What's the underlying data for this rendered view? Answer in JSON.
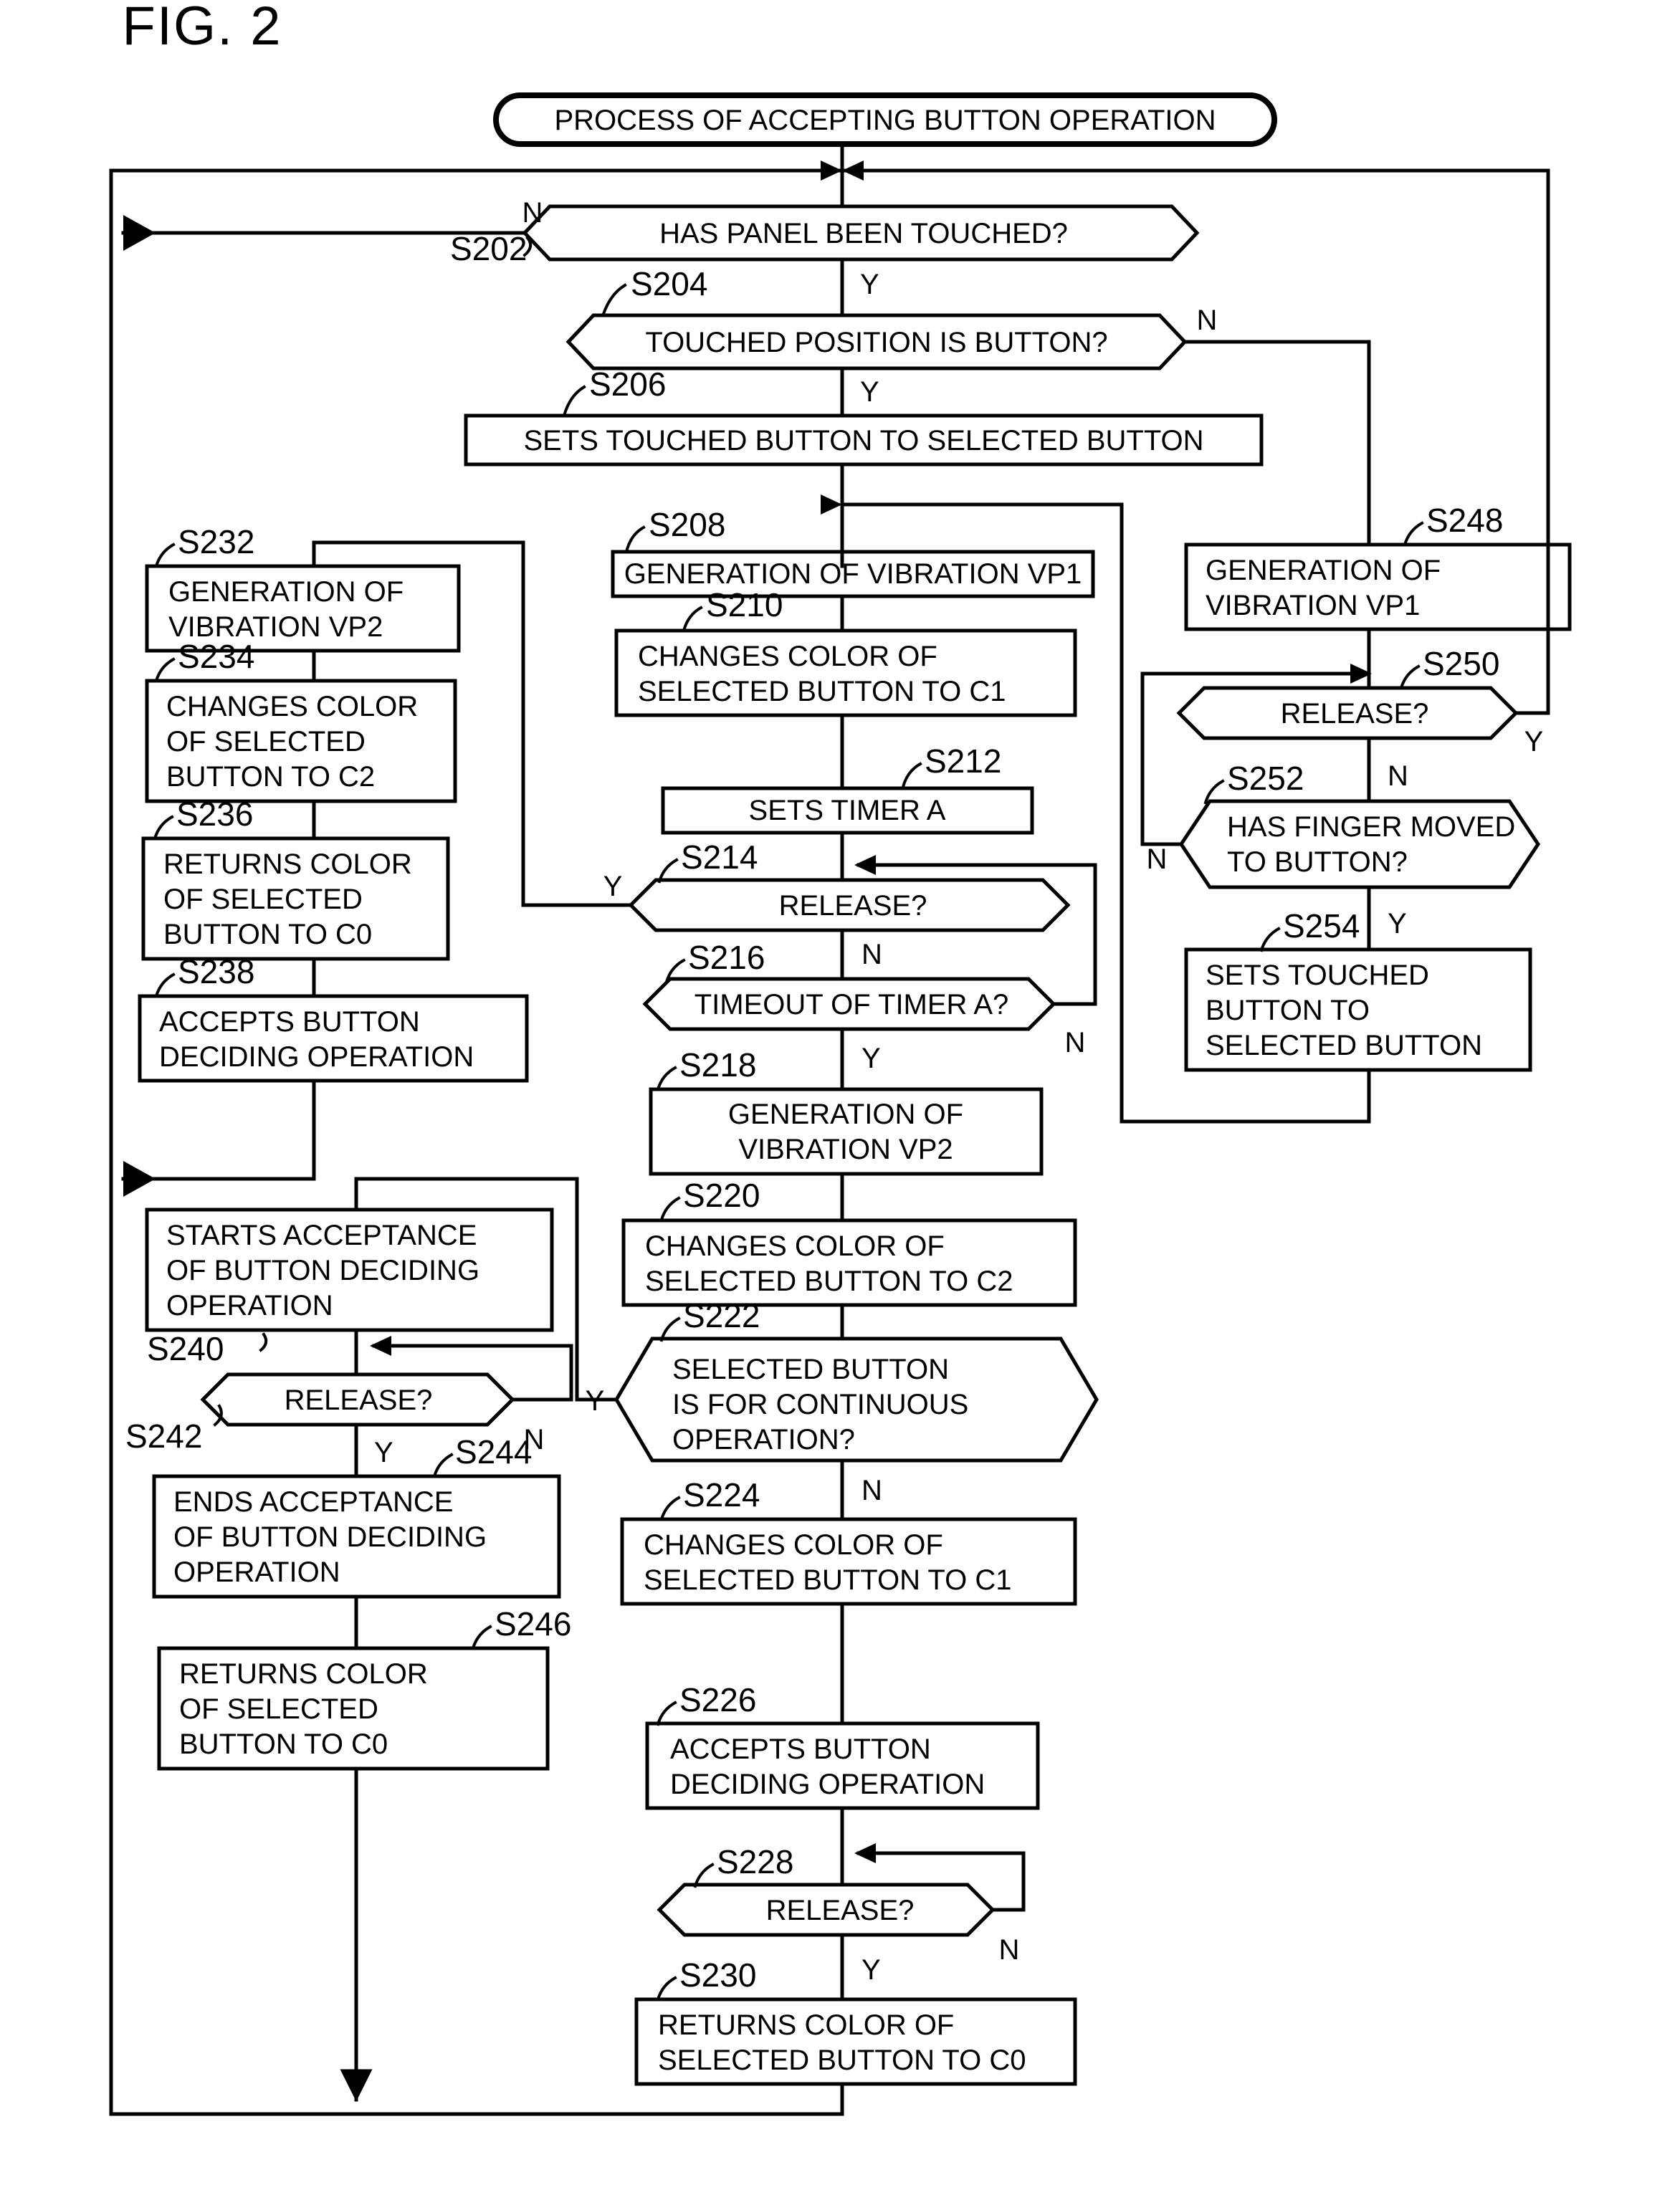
{
  "figure": {
    "title": "FIG. 2",
    "start_node": "PROCESS OF ACCEPTING BUTTON OPERATION"
  },
  "labels": {
    "yes": "Y",
    "no": "N"
  },
  "nodes": [
    {
      "id": "S202",
      "step": "S202",
      "shape": "decision",
      "text": [
        "HAS PANEL BEEN TOUCHED?"
      ]
    },
    {
      "id": "S204",
      "step": "S204",
      "shape": "decision",
      "text": [
        "TOUCHED POSITION IS BUTTON?"
      ]
    },
    {
      "id": "S206",
      "step": "S206",
      "shape": "process",
      "text": [
        "SETS TOUCHED BUTTON TO SELECTED BUTTON"
      ]
    },
    {
      "id": "S208",
      "step": "S208",
      "shape": "process",
      "text": [
        "GENERATION OF VIBRATION VP1"
      ]
    },
    {
      "id": "S210",
      "step": "S210",
      "shape": "process",
      "text": [
        "CHANGES COLOR OF",
        "SELECTED BUTTON TO C1"
      ]
    },
    {
      "id": "S212",
      "step": "S212",
      "shape": "process",
      "text": [
        "SETS TIMER A"
      ]
    },
    {
      "id": "S214",
      "step": "S214",
      "shape": "decision",
      "text": [
        "RELEASE?"
      ]
    },
    {
      "id": "S216",
      "step": "S216",
      "shape": "decision",
      "text": [
        "TIMEOUT OF TIMER A?"
      ]
    },
    {
      "id": "S218",
      "step": "S218",
      "shape": "process",
      "text": [
        "GENERATION OF",
        "VIBRATION VP2"
      ]
    },
    {
      "id": "S220",
      "step": "S220",
      "shape": "process",
      "text": [
        "CHANGES COLOR OF",
        "SELECTED BUTTON TO C2"
      ]
    },
    {
      "id": "S222",
      "step": "S222",
      "shape": "decision",
      "text": [
        "SELECTED BUTTON",
        "IS FOR CONTINUOUS",
        "OPERATION?"
      ]
    },
    {
      "id": "S224",
      "step": "S224",
      "shape": "process",
      "text": [
        "CHANGES COLOR OF",
        "SELECTED BUTTON TO C1"
      ]
    },
    {
      "id": "S226",
      "step": "S226",
      "shape": "process",
      "text": [
        "ACCEPTS BUTTON",
        "DECIDING OPERATION"
      ]
    },
    {
      "id": "S228",
      "step": "S228",
      "shape": "decision",
      "text": [
        "RELEASE?"
      ]
    },
    {
      "id": "S230",
      "step": "S230",
      "shape": "process",
      "text": [
        "RETURNS COLOR OF",
        "SELECTED BUTTON TO C0"
      ]
    },
    {
      "id": "S232",
      "step": "S232",
      "shape": "process",
      "text": [
        "GENERATION OF",
        "VIBRATION VP2"
      ]
    },
    {
      "id": "S234",
      "step": "S234",
      "shape": "process",
      "text": [
        "CHANGES COLOR",
        "OF SELECTED",
        "BUTTON TO C2"
      ]
    },
    {
      "id": "S236",
      "step": "S236",
      "shape": "process",
      "text": [
        "RETURNS COLOR",
        "OF SELECTED",
        "BUTTON TO C0"
      ]
    },
    {
      "id": "S238",
      "step": "S238",
      "shape": "process",
      "text": [
        "ACCEPTS BUTTON",
        "DECIDING OPERATION"
      ]
    },
    {
      "id": "S240",
      "step": "S240",
      "shape": "process",
      "text": [
        "STARTS ACCEPTANCE",
        "OF BUTTON DECIDING",
        "OPERATION"
      ]
    },
    {
      "id": "S242",
      "step": "S242",
      "shape": "decision",
      "text": [
        "RELEASE?"
      ]
    },
    {
      "id": "S244",
      "step": "S244",
      "shape": "process",
      "text": [
        "ENDS ACCEPTANCE",
        "OF BUTTON DECIDING",
        "OPERATION"
      ]
    },
    {
      "id": "S246",
      "step": "S246",
      "shape": "process",
      "text": [
        "RETURNS COLOR",
        "OF SELECTED",
        "BUTTON TO C0"
      ]
    },
    {
      "id": "S248",
      "step": "S248",
      "shape": "process",
      "text": [
        "GENERATION OF",
        "VIBRATION VP1"
      ]
    },
    {
      "id": "S250",
      "step": "S250",
      "shape": "decision",
      "text": [
        "RELEASE?"
      ]
    },
    {
      "id": "S252",
      "step": "S252",
      "shape": "decision",
      "text": [
        "HAS FINGER MOVED",
        "TO BUTTON?"
      ]
    },
    {
      "id": "S254",
      "step": "S254",
      "shape": "process",
      "text": [
        "SETS TOUCHED",
        "BUTTON TO",
        "SELECTED BUTTON"
      ]
    }
  ],
  "branch_labels": [
    {
      "node": "S202",
      "branch": "N"
    },
    {
      "node": "S202",
      "branch": "Y"
    },
    {
      "node": "S204",
      "branch": "N"
    },
    {
      "node": "S204",
      "branch": "Y"
    },
    {
      "node": "S214",
      "branch": "Y"
    },
    {
      "node": "S214",
      "branch": "N"
    },
    {
      "node": "S216",
      "branch": "N"
    },
    {
      "node": "S216",
      "branch": "Y"
    },
    {
      "node": "S222",
      "branch": "Y"
    },
    {
      "node": "S222",
      "branch": "N"
    },
    {
      "node": "S228",
      "branch": "N"
    },
    {
      "node": "S228",
      "branch": "Y"
    },
    {
      "node": "S242",
      "branch": "N"
    },
    {
      "node": "S242",
      "branch": "Y"
    },
    {
      "node": "S250",
      "branch": "Y"
    },
    {
      "node": "S250",
      "branch": "N"
    },
    {
      "node": "S252",
      "branch": "N"
    },
    {
      "node": "S252",
      "branch": "Y"
    }
  ],
  "colors": {
    "stroke": "#000000",
    "background": "#ffffff"
  }
}
